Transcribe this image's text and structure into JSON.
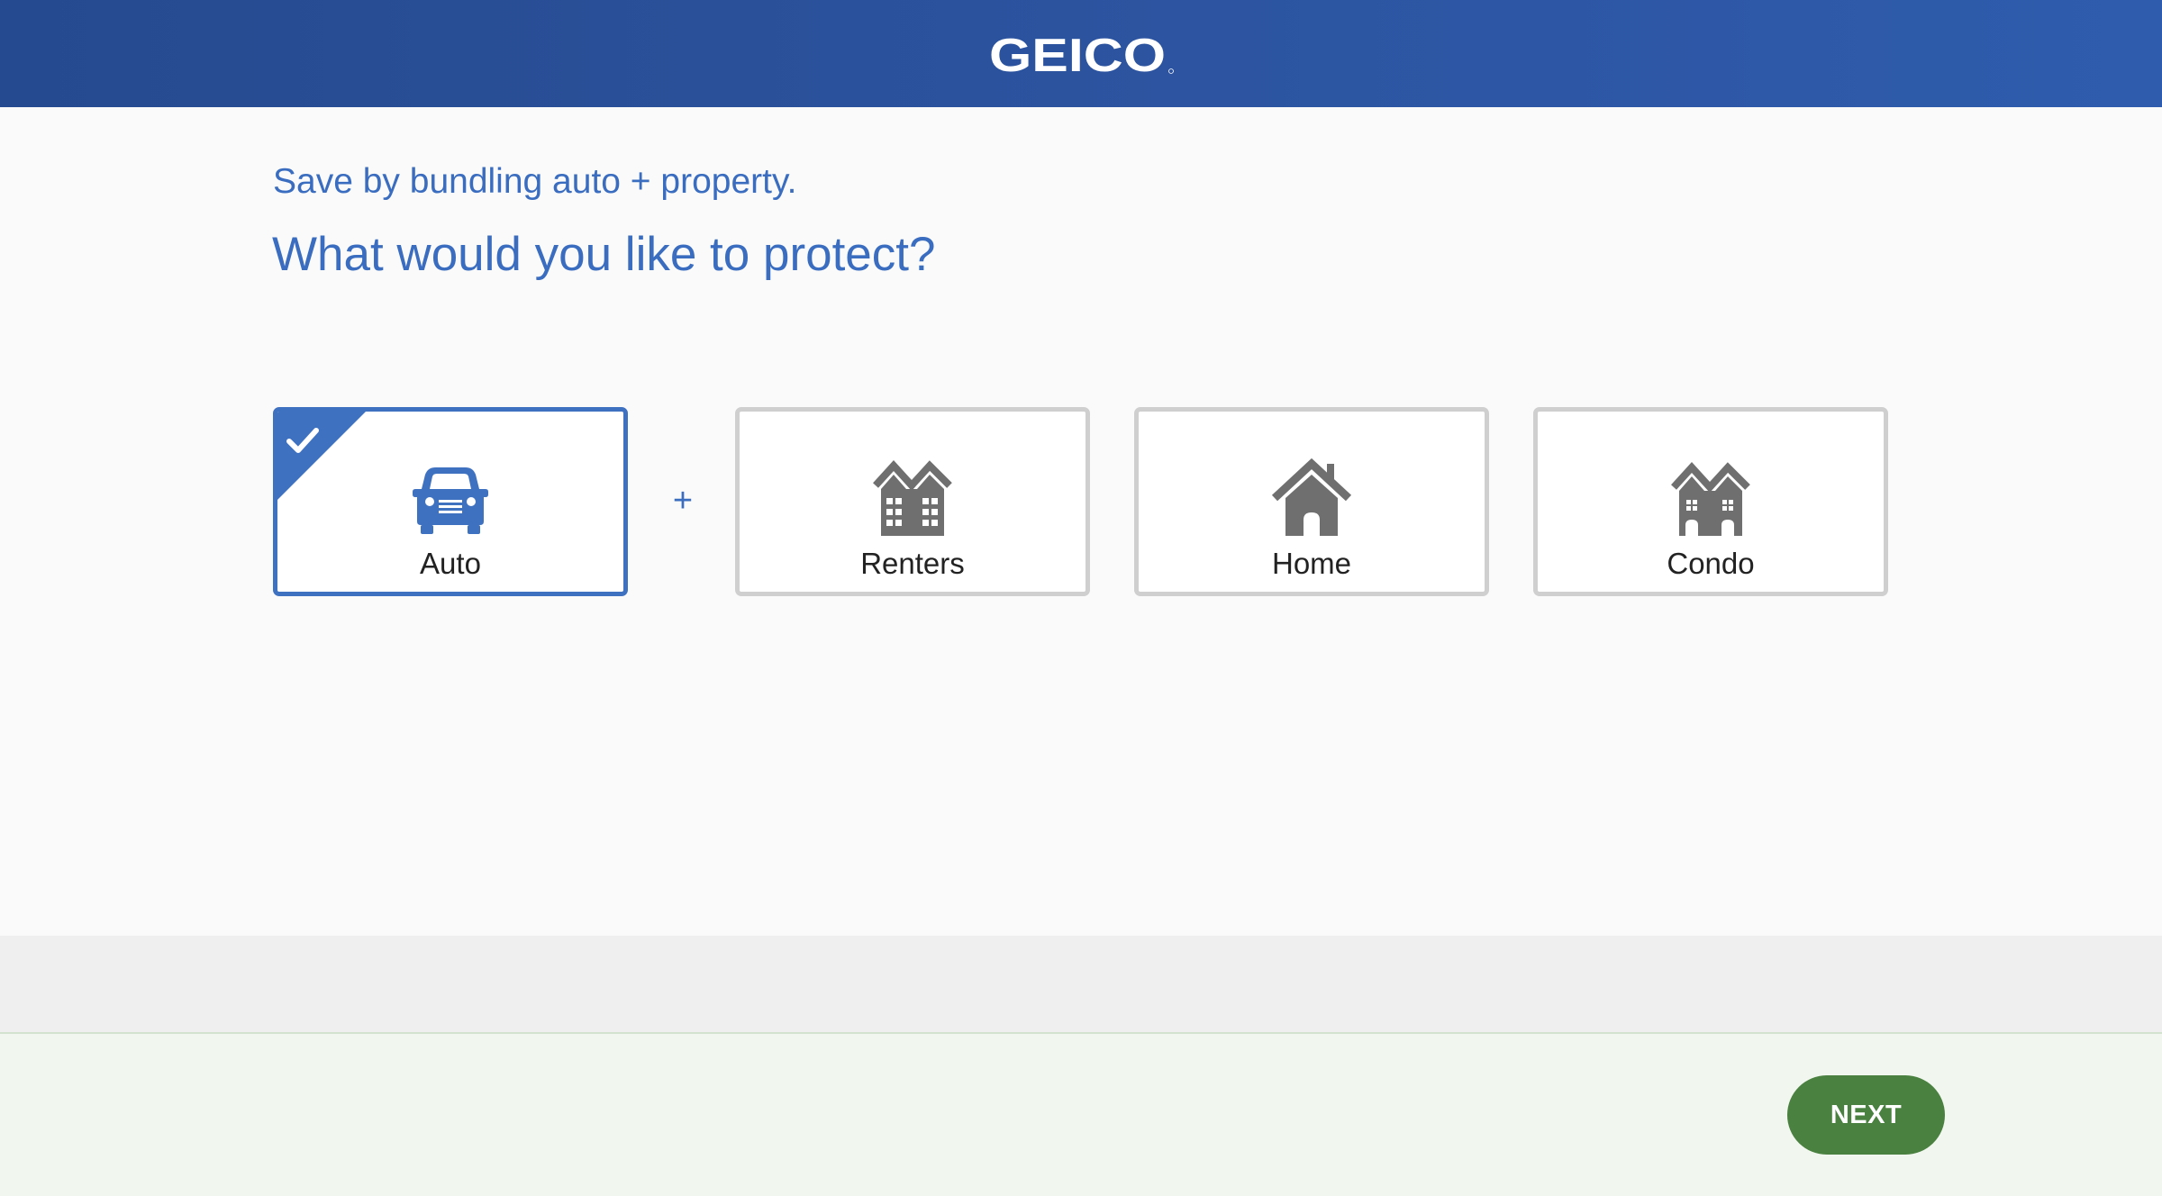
{
  "header": {
    "logo_text": "GEICO",
    "background_color": "#2c54a0"
  },
  "main": {
    "subtitle": "Save by bundling auto + property.",
    "title": "What would you like to protect?",
    "plus_sign": "+",
    "options": [
      {
        "label": "Auto",
        "icon": "car-icon",
        "selected": true
      },
      {
        "label": "Renters",
        "icon": "apartment-building-icon",
        "selected": false
      },
      {
        "label": "Home",
        "icon": "house-icon",
        "selected": false
      },
      {
        "label": "Condo",
        "icon": "condo-building-icon",
        "selected": false
      }
    ],
    "accent_color": "#3f71c1",
    "icon_color": "#6f6f6f"
  },
  "footer": {
    "next_label": "NEXT",
    "next_color": "#4a8040"
  }
}
